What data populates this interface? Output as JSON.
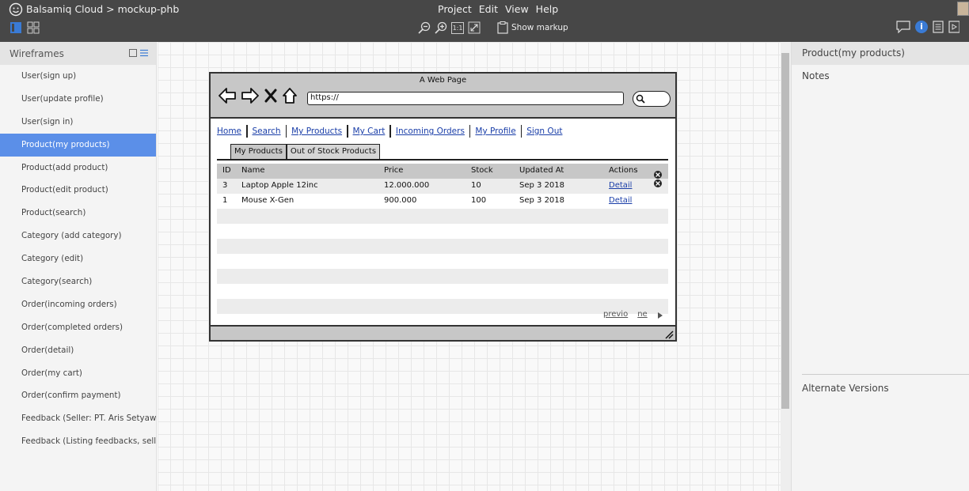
{
  "app": {
    "title": "Balsamiq Cloud > mockup-phb",
    "menus": [
      "Project",
      "Edit",
      "View",
      "Help"
    ],
    "toolbar": {
      "zoom_actual": "1:1",
      "show_markup": "Show markup"
    }
  },
  "sidebar": {
    "header": "Wireframes",
    "items": [
      {
        "label": "User(sign up)"
      },
      {
        "label": "User(update profile)"
      },
      {
        "label": "User(sign in)"
      },
      {
        "label": "Product(my products)",
        "active": true
      },
      {
        "label": "Product(add product)"
      },
      {
        "label": "Product(edit product)"
      },
      {
        "label": "Product(search)"
      },
      {
        "label": "Category (add category)"
      },
      {
        "label": "Category (edit)"
      },
      {
        "label": "Category(search)"
      },
      {
        "label": "Order(incoming orders)"
      },
      {
        "label": "Order(completed orders)"
      },
      {
        "label": "Order(detail)"
      },
      {
        "label": "Order(my cart)"
      },
      {
        "label": "Order(confirm payment)"
      },
      {
        "label": "Feedback (Seller: PT. Aris Setyawa..."
      },
      {
        "label": "Feedback (Listing feedbacks, selle..."
      }
    ]
  },
  "mockup": {
    "page_title": "A Web Page",
    "url": "https://",
    "nav_links": [
      "Home",
      "Search",
      "My Products",
      "My Cart",
      "Incoming Orders",
      "My Profile",
      "Sign Out"
    ],
    "tabs": [
      "My Products",
      "Out of Stock Products"
    ],
    "table": {
      "headers": [
        "ID",
        "Name",
        "Price",
        "Stock",
        "Updated At",
        "Actions"
      ],
      "rows": [
        {
          "id": "3",
          "name": "Laptop Apple 12inc",
          "price": "12.000.000",
          "stock": "10",
          "updated": "Sep 3 2018",
          "action": "Detail"
        },
        {
          "id": "1",
          "name": "Mouse X-Gen",
          "price": "900.000",
          "stock": "100",
          "updated": "Sep 3 2018",
          "action": "Detail"
        }
      ]
    },
    "pager": {
      "prev": "previo",
      "next": "ne"
    }
  },
  "right_panel": {
    "title": "Product(my products)",
    "notes": "Notes",
    "alternate_versions": "Alternate Versions"
  },
  "colors": {
    "accent": "#5b8fe8",
    "info": "#3a7bd5",
    "toolbar_bg": "#474747"
  }
}
